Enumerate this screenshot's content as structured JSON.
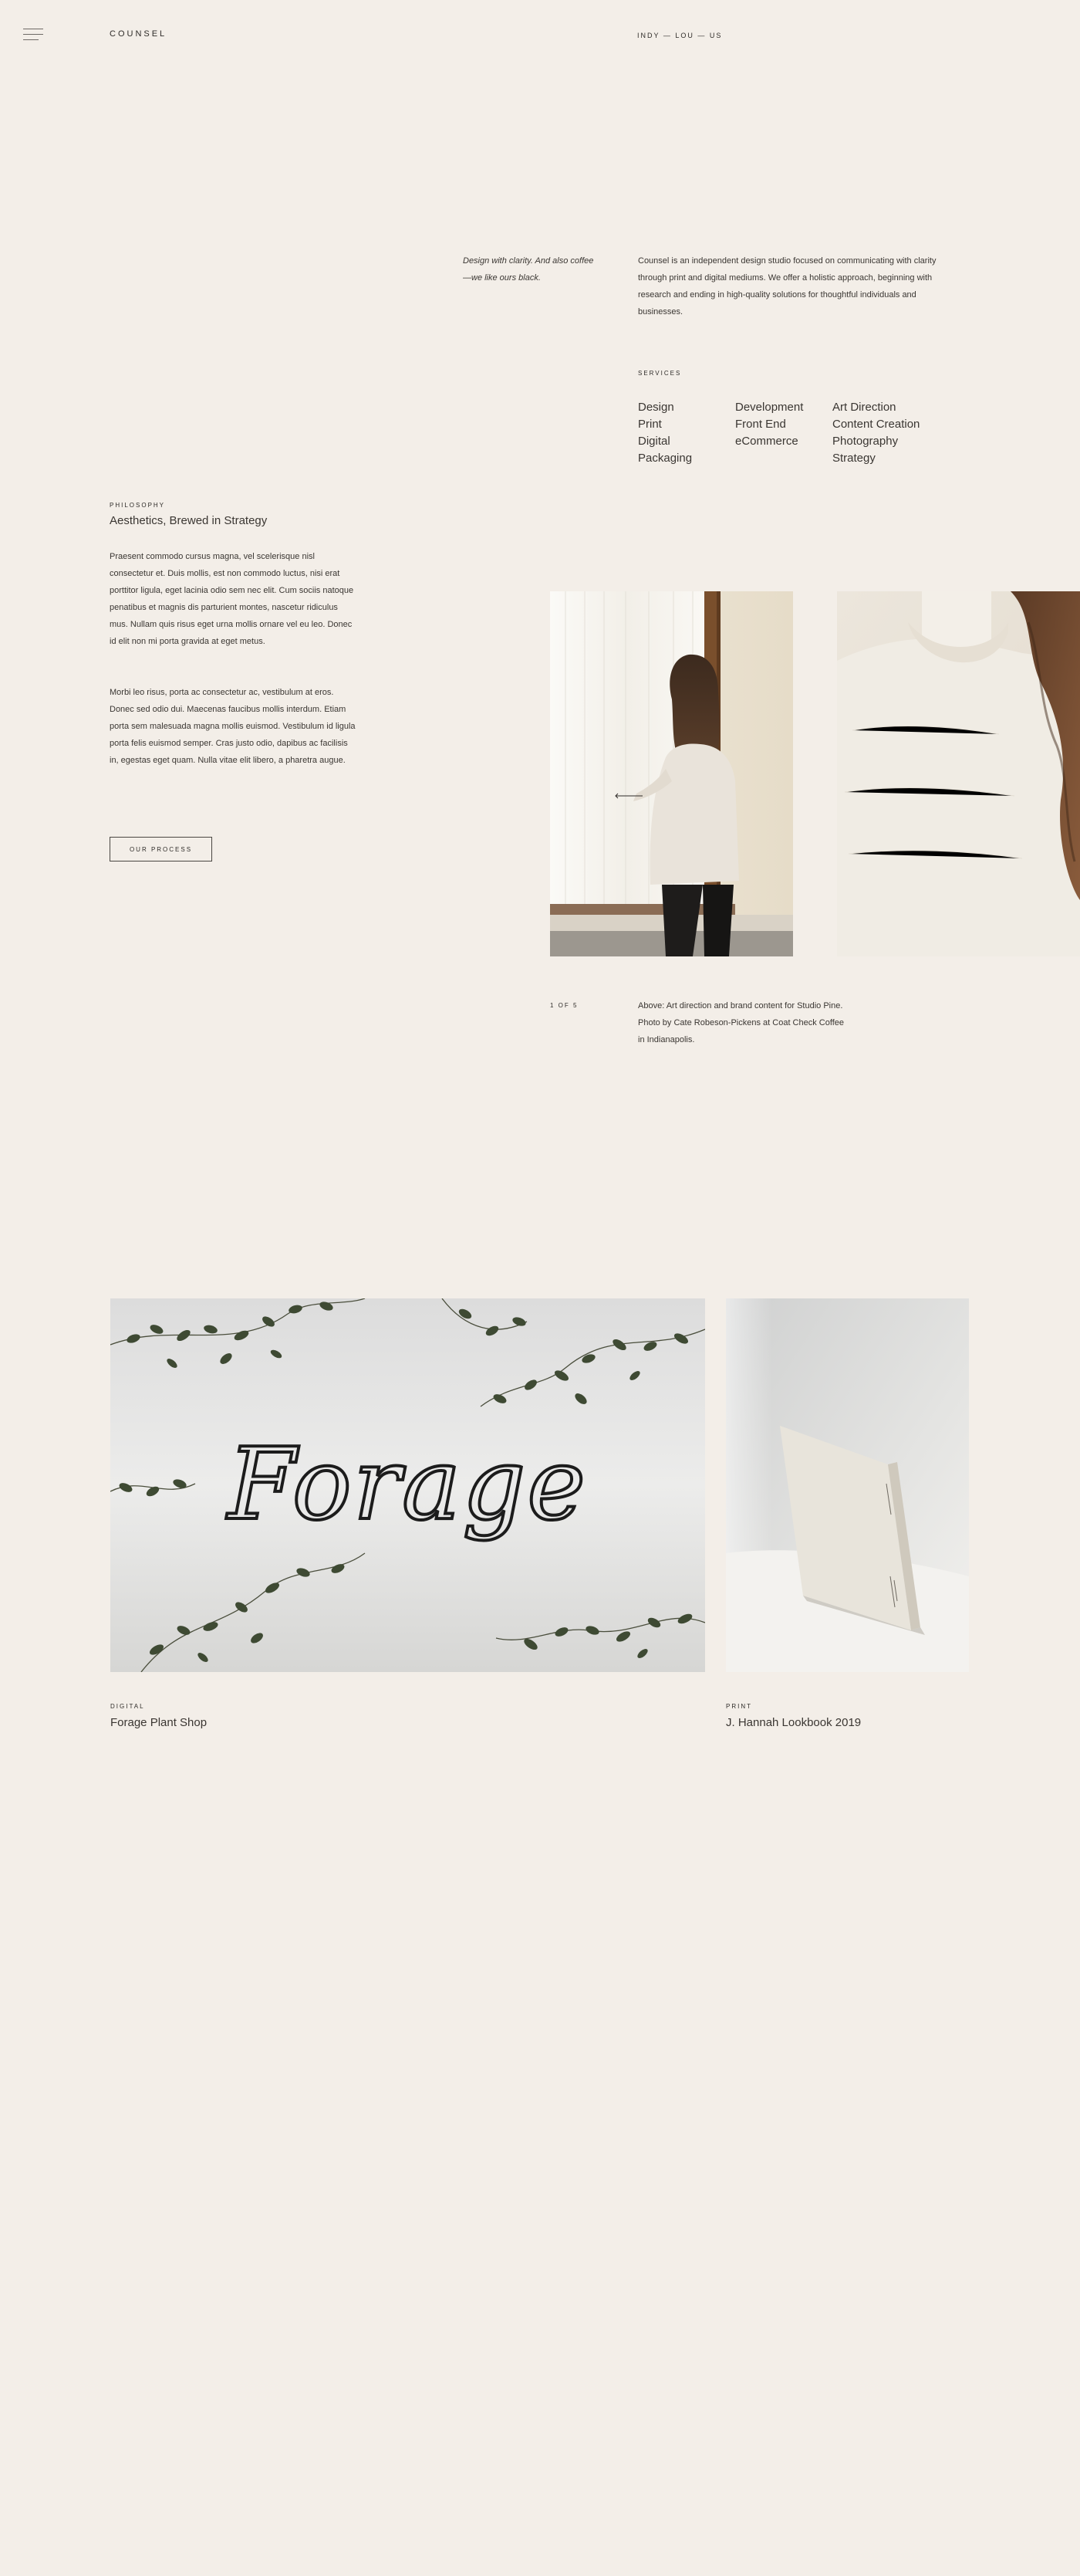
{
  "header": {
    "brand": "COUNSEL",
    "locations": "INDY — LOU — US",
    "menu_icon": "hamburger-menu-icon"
  },
  "intro": {
    "tagline": "Design with clarity. And also coffee—we like ours black.",
    "text": "Counsel is an independent design studio focused on communicating with clarity through print and digital mediums. We offer a holistic approach, beginning with research and ending in high-quality solutions for thoughtful individuals and businesses."
  },
  "services": {
    "eyebrow": "SERVICES",
    "columns": [
      [
        "Design",
        "Print",
        "Digital",
        "Packaging"
      ],
      [
        "Development",
        "Front End",
        "eCommerce"
      ],
      [
        "Art Direction",
        "Content Creation",
        "Photography",
        "Strategy"
      ]
    ]
  },
  "philosophy": {
    "eyebrow": "PHILOSOPHY",
    "title": "Aesthetics, Brewed in Strategy",
    "paragraphs": [
      "Praesent commodo cursus magna, vel scelerisque nisl consectetur et. Duis mollis, est non commodo luctus, nisi erat porttitor ligula, eget lacinia odio sem nec elit. Cum sociis natoque penatibus et magnis dis parturient montes, nascetur ridiculus mus. Nullam quis risus eget urna mollis ornare vel eu leo. Donec id elit non mi porta gravida at eget metus.",
      "Morbi leo risus, porta ac consectetur ac, vestibulum at eros. Donec sed odio dui. Maecenas faucibus mollis interdum. Etiam porta sem malesuada magna mollis euismod. Vestibulum id ligula porta felis euismod semper. Cras justo odio, dapibus ac facilisis in, egestas eget quam. Nulla vitae elit libero, a pharetra augue."
    ],
    "button": "OUR PROCESS"
  },
  "gallery": {
    "counter": "1 OF 5",
    "caption": "Above: Art direction and brand content for Studio Pine. Photo by Cate Robeson-Pickens at Coat Check Coffee in Indianapolis.",
    "prev_icon": "arrow-left-icon"
  },
  "projects": [
    {
      "category": "DIGITAL",
      "title": "Forage Plant Shop",
      "sign_text": "Forage"
    },
    {
      "category": "PRINT",
      "title": "J. Hannah Lookbook 2019"
    }
  ]
}
